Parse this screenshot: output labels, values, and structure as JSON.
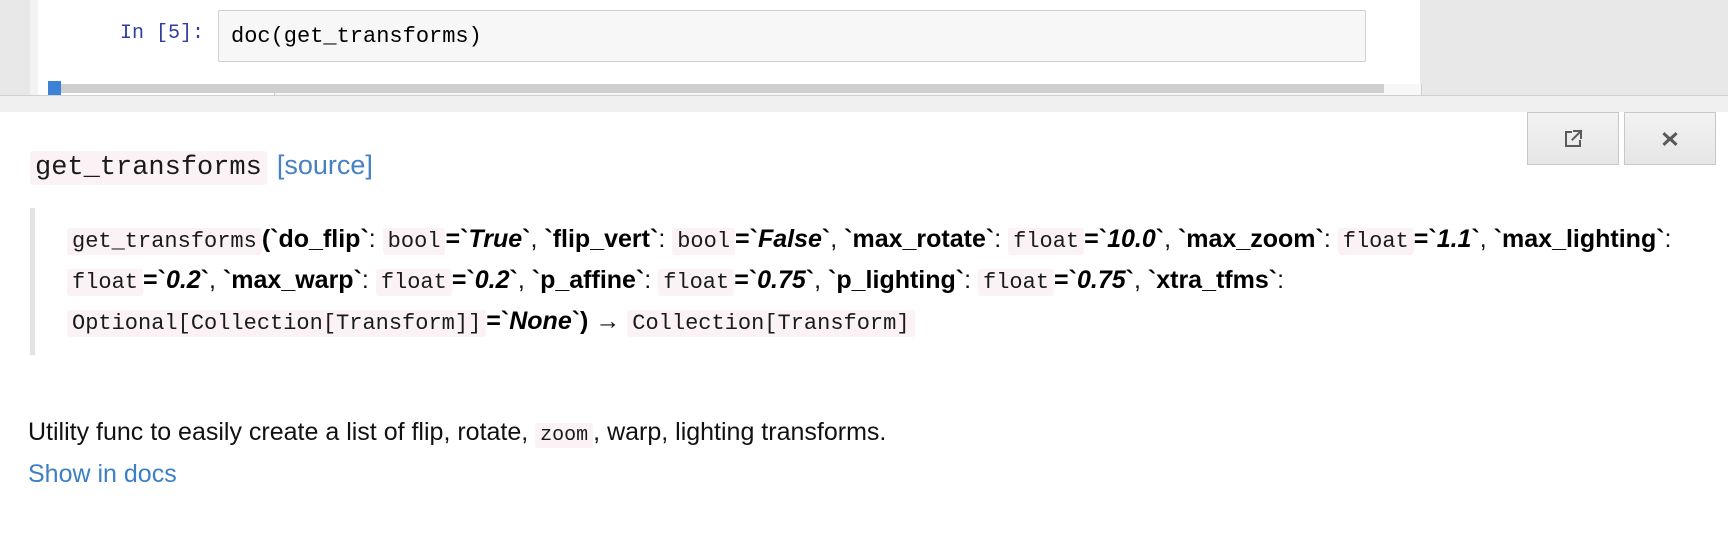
{
  "notebook": {
    "prompt_label": "In [5]:",
    "cell_code": "doc(get_transforms)"
  },
  "doc_panel": {
    "buttons": [
      {
        "name": "open-in-new-window",
        "icon": "external-link-icon",
        "label": ""
      },
      {
        "name": "close-panel",
        "icon": "close-icon",
        "label": "✖"
      }
    ],
    "title": "get_transforms",
    "source_link": "[source]",
    "signature": {
      "func_name": "get_transforms",
      "open_paren": "(",
      "params": [
        {
          "name": "do_flip",
          "type": "bool",
          "eq": "=",
          "value": "True",
          "sep": ","
        },
        {
          "name": "flip_vert",
          "type": "bool",
          "eq": "=",
          "value": "False",
          "sep": ","
        },
        {
          "name": "max_rotate",
          "type": "float",
          "eq": "=",
          "value": "10.0",
          "sep": ","
        },
        {
          "name": "max_zoom",
          "type": "float",
          "eq": "=",
          "value": "1.1",
          "sep": ","
        },
        {
          "name": "max_lighting",
          "type": "float",
          "eq": "=",
          "value": "0.2",
          "sep": ","
        },
        {
          "name": "max_warp",
          "type": "float",
          "eq": "=",
          "value": "0.2",
          "sep": ","
        },
        {
          "name": "p_affine",
          "type": "float",
          "eq": "=",
          "value": "0.75",
          "sep": ","
        },
        {
          "name": "p_lighting",
          "type": "float",
          "eq": "=",
          "value": "0.75",
          "sep": ","
        },
        {
          "name": "xtra_tfms",
          "type": "Optional[Collection[Transform]]",
          "eq": "=",
          "value": "None",
          "sep": ""
        }
      ],
      "close_paren": ")",
      "arrow": "→",
      "return_type": "Collection[Transform]"
    },
    "description": {
      "before": "Utility func to easily create a list of flip, rotate, ",
      "code": "zoom",
      "after": ", warp, lighting transforms."
    },
    "show_in_docs": "Show in docs"
  },
  "colors": {
    "link_blue": "#4682c3",
    "prompt_blue": "#303f9f",
    "code_bg": "#faf2f4",
    "panel_bg": "#ffffff",
    "chrome_gray": "#e8e8e8"
  }
}
